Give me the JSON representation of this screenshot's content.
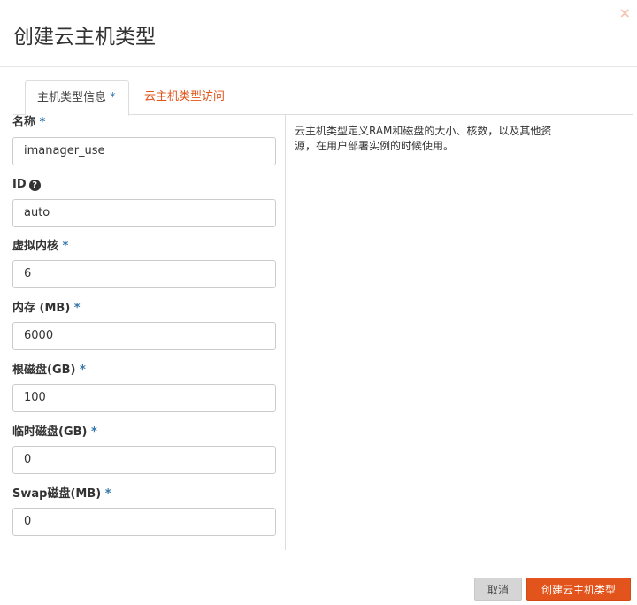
{
  "dialog": {
    "title": "创建云主机类型",
    "close_symbol": "×"
  },
  "tabs": [
    {
      "label": "主机类型信息",
      "required_mark": "*",
      "active": true
    },
    {
      "label": "云主机类型访问",
      "active": false
    }
  ],
  "form": {
    "required_mark": "*",
    "fields": [
      {
        "label": "名称",
        "value": "imanager_use",
        "required": true
      },
      {
        "label": "ID",
        "value": "auto",
        "required": false,
        "help_icon": "question-circle-icon",
        "help_symbol": "?"
      },
      {
        "label": "虚拟内核",
        "value": "6",
        "required": true
      },
      {
        "label": "内存 (MB)",
        "value": "6000",
        "required": true
      },
      {
        "label": "根磁盘(GB)",
        "value": "100",
        "required": true
      },
      {
        "label": "临时磁盘(GB)",
        "value": "0",
        "required": true
      },
      {
        "label": "Swap磁盘(MB)",
        "value": "0",
        "required": true
      }
    ]
  },
  "description": {
    "line1": "云主机类型定义RAM和磁盘的大小、核数，以及其他资",
    "line2": "源，在用户部署实例的时候使用。"
  },
  "footer": {
    "cancel_label": "取消",
    "submit_label": "创建云主机类型"
  },
  "colors": {
    "accent": "#e2541b",
    "required": "#3377aa"
  }
}
